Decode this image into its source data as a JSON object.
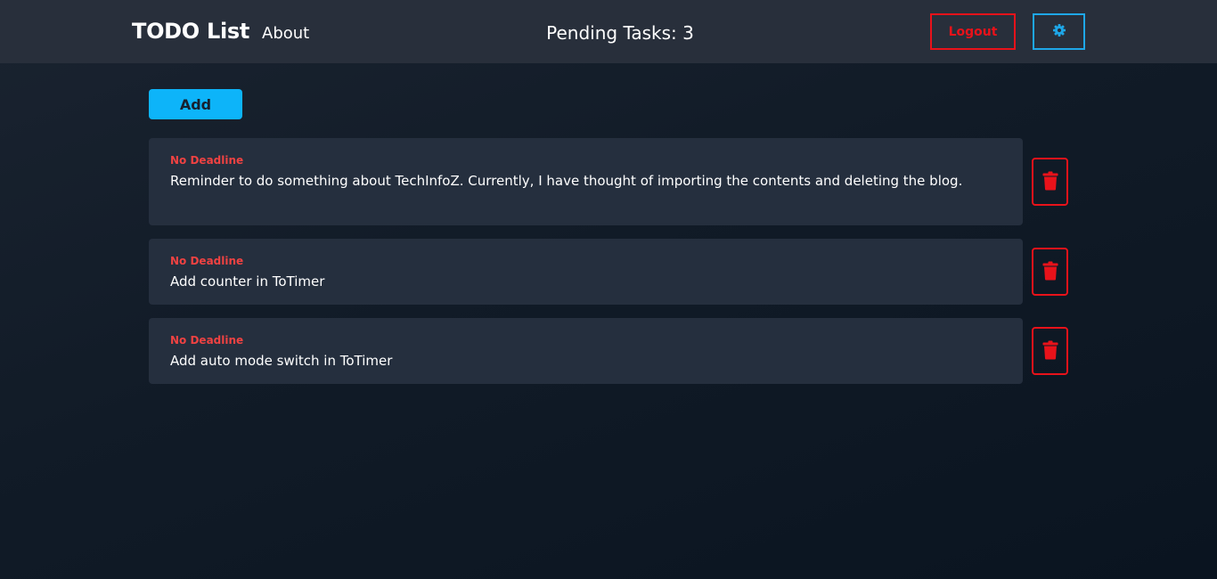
{
  "navbar": {
    "brand": "TODO List",
    "about_link": "About",
    "pending_label": "Pending Tasks: 3",
    "logout_label": "Logout",
    "settings_icon": "gear-icon"
  },
  "actions": {
    "add_label": "Add"
  },
  "todos": [
    {
      "deadline": "No Deadline",
      "text": "Reminder to do something about TechInfoZ. Currently, I have thought of importing the contents and deleting the blog.",
      "delete_icon": "trash-icon"
    },
    {
      "deadline": "No Deadline",
      "text": "Add counter in ToTimer",
      "delete_icon": "trash-icon"
    },
    {
      "deadline": "No Deadline",
      "text": "Add auto mode switch in ToTimer",
      "delete_icon": "trash-icon"
    }
  ],
  "colors": {
    "navbar_bg": "#282f3b",
    "accent_blue": "#0db4f9",
    "danger_red": "#e8121a",
    "deadline_red": "#ef4242",
    "card_bg": "#252f3e"
  }
}
